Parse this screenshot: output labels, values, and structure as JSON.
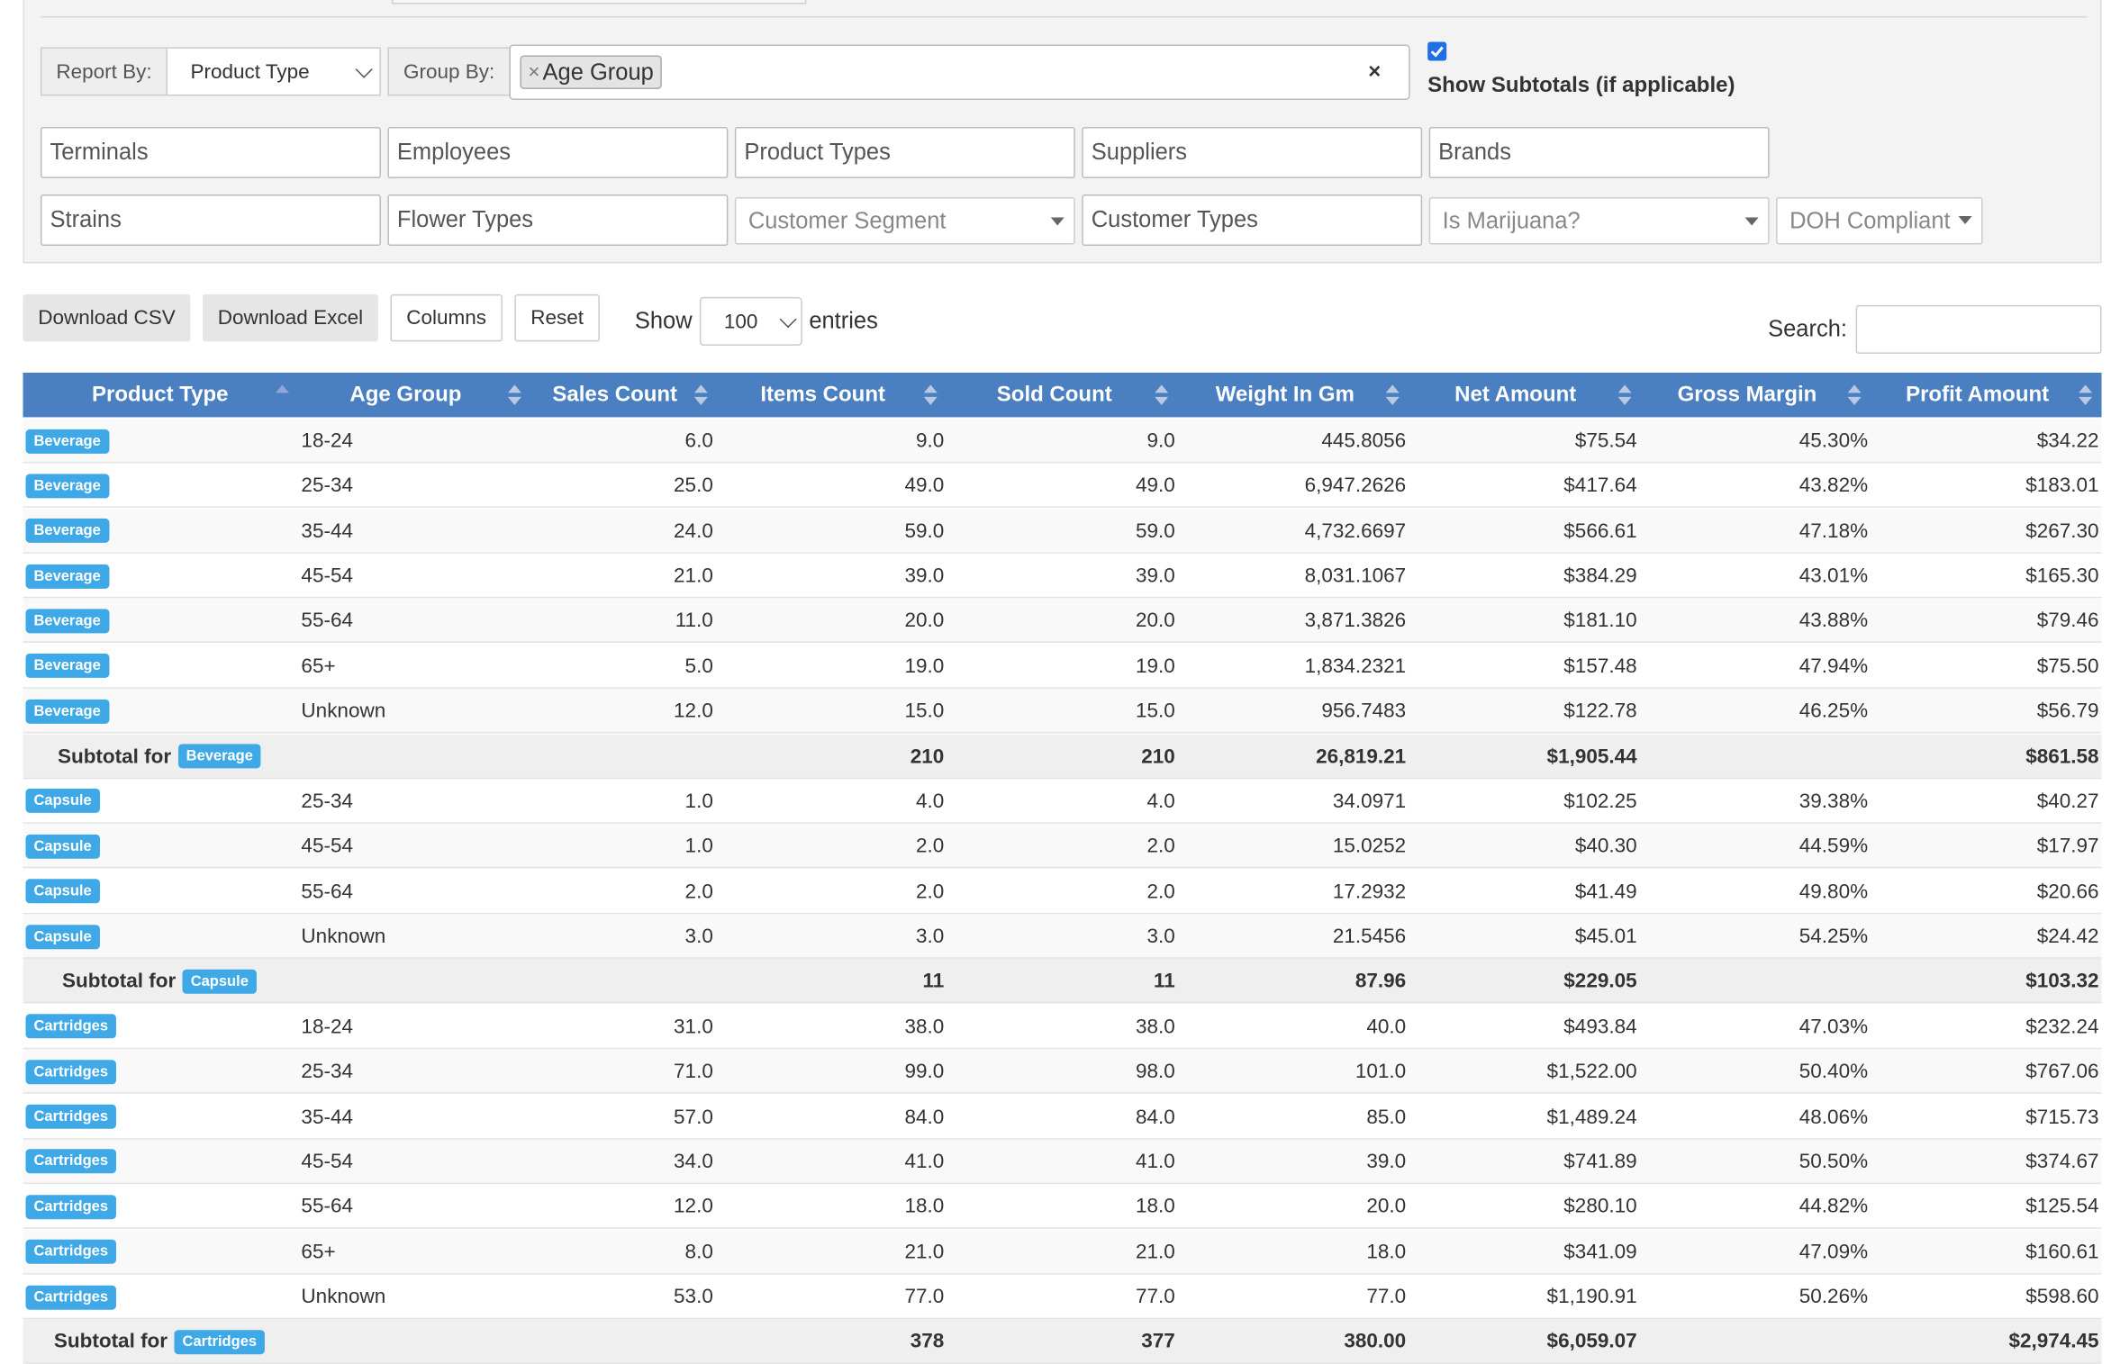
{
  "filters": {
    "report_by_label": "Report By:",
    "report_by_value": "Product Type",
    "group_by_label": "Group By:",
    "group_by_tag": "Age Group",
    "tag_remove": "×",
    "clear": "×",
    "show_subtotals_label": "Show Subtotals (if applicable)",
    "show_subtotals_checked": true,
    "row1": [
      "Terminals",
      "Employees",
      "Product Types",
      "Suppliers",
      "Brands"
    ],
    "row2": {
      "strains": "Strains",
      "flower_types": "Flower Types",
      "customer_segment": "Customer Segment",
      "customer_types": "Customer Types",
      "is_marijuana": "Is Marijuana?",
      "doh_compliant": "DOH Compliant"
    }
  },
  "toolbar": {
    "download_csv": "Download CSV",
    "download_excel": "Download Excel",
    "columns": "Columns",
    "reset": "Reset",
    "show_label": "Show",
    "entries_value": "100",
    "entries_label": "entries",
    "search_label": "Search:",
    "search_value": ""
  },
  "table": {
    "columns": [
      "Product Type",
      "Age Group",
      "Sales Count",
      "Items Count",
      "Sold Count",
      "Weight In Gm",
      "Net Amount",
      "Gross Margin",
      "Profit Amount"
    ],
    "subtotal_prefix": "Subtotal for",
    "rows": [
      {
        "type": "data",
        "product": "Beverage",
        "age": "18-24",
        "sales": "6.0",
        "items": "9.0",
        "sold": "9.0",
        "weight": "445.8056",
        "net": "$75.54",
        "margin": "45.30%",
        "profit": "$34.22"
      },
      {
        "type": "data",
        "product": "Beverage",
        "age": "25-34",
        "sales": "25.0",
        "items": "49.0",
        "sold": "49.0",
        "weight": "6,947.2626",
        "net": "$417.64",
        "margin": "43.82%",
        "profit": "$183.01"
      },
      {
        "type": "data",
        "product": "Beverage",
        "age": "35-44",
        "sales": "24.0",
        "items": "59.0",
        "sold": "59.0",
        "weight": "4,732.6697",
        "net": "$566.61",
        "margin": "47.18%",
        "profit": "$267.30"
      },
      {
        "type": "data",
        "product": "Beverage",
        "age": "45-54",
        "sales": "21.0",
        "items": "39.0",
        "sold": "39.0",
        "weight": "8,031.1067",
        "net": "$384.29",
        "margin": "43.01%",
        "profit": "$165.30"
      },
      {
        "type": "data",
        "product": "Beverage",
        "age": "55-64",
        "sales": "11.0",
        "items": "20.0",
        "sold": "20.0",
        "weight": "3,871.3826",
        "net": "$181.10",
        "margin": "43.88%",
        "profit": "$79.46"
      },
      {
        "type": "data",
        "product": "Beverage",
        "age": "65+",
        "sales": "5.0",
        "items": "19.0",
        "sold": "19.0",
        "weight": "1,834.2321",
        "net": "$157.48",
        "margin": "47.94%",
        "profit": "$75.50"
      },
      {
        "type": "data",
        "product": "Beverage",
        "age": "Unknown",
        "sales": "12.0",
        "items": "15.0",
        "sold": "15.0",
        "weight": "956.7483",
        "net": "$122.78",
        "margin": "46.25%",
        "profit": "$56.79"
      },
      {
        "type": "subtotal",
        "product": "Beverage",
        "items": "210",
        "sold": "210",
        "weight": "26,819.21",
        "net": "$1,905.44",
        "profit": "$861.58"
      },
      {
        "type": "data",
        "product": "Capsule",
        "age": "25-34",
        "sales": "1.0",
        "items": "4.0",
        "sold": "4.0",
        "weight": "34.0971",
        "net": "$102.25",
        "margin": "39.38%",
        "profit": "$40.27"
      },
      {
        "type": "data",
        "product": "Capsule",
        "age": "45-54",
        "sales": "1.0",
        "items": "2.0",
        "sold": "2.0",
        "weight": "15.0252",
        "net": "$40.30",
        "margin": "44.59%",
        "profit": "$17.97"
      },
      {
        "type": "data",
        "product": "Capsule",
        "age": "55-64",
        "sales": "2.0",
        "items": "2.0",
        "sold": "2.0",
        "weight": "17.2932",
        "net": "$41.49",
        "margin": "49.80%",
        "profit": "$20.66"
      },
      {
        "type": "data",
        "product": "Capsule",
        "age": "Unknown",
        "sales": "3.0",
        "items": "3.0",
        "sold": "3.0",
        "weight": "21.5456",
        "net": "$45.01",
        "margin": "54.25%",
        "profit": "$24.42"
      },
      {
        "type": "subtotal",
        "product": "Capsule",
        "items": "11",
        "sold": "11",
        "weight": "87.96",
        "net": "$229.05",
        "profit": "$103.32"
      },
      {
        "type": "data",
        "product": "Cartridges",
        "age": "18-24",
        "sales": "31.0",
        "items": "38.0",
        "sold": "38.0",
        "weight": "40.0",
        "net": "$493.84",
        "margin": "47.03%",
        "profit": "$232.24"
      },
      {
        "type": "data",
        "product": "Cartridges",
        "age": "25-34",
        "sales": "71.0",
        "items": "99.0",
        "sold": "98.0",
        "weight": "101.0",
        "net": "$1,522.00",
        "margin": "50.40%",
        "profit": "$767.06"
      },
      {
        "type": "data",
        "product": "Cartridges",
        "age": "35-44",
        "sales": "57.0",
        "items": "84.0",
        "sold": "84.0",
        "weight": "85.0",
        "net": "$1,489.24",
        "margin": "48.06%",
        "profit": "$715.73"
      },
      {
        "type": "data",
        "product": "Cartridges",
        "age": "45-54",
        "sales": "34.0",
        "items": "41.0",
        "sold": "41.0",
        "weight": "39.0",
        "net": "$741.89",
        "margin": "50.50%",
        "profit": "$374.67"
      },
      {
        "type": "data",
        "product": "Cartridges",
        "age": "55-64",
        "sales": "12.0",
        "items": "18.0",
        "sold": "18.0",
        "weight": "20.0",
        "net": "$280.10",
        "margin": "44.82%",
        "profit": "$125.54"
      },
      {
        "type": "data",
        "product": "Cartridges",
        "age": "65+",
        "sales": "8.0",
        "items": "21.0",
        "sold": "21.0",
        "weight": "18.0",
        "net": "$341.09",
        "margin": "47.09%",
        "profit": "$160.61"
      },
      {
        "type": "data",
        "product": "Cartridges",
        "age": "Unknown",
        "sales": "53.0",
        "items": "77.0",
        "sold": "77.0",
        "weight": "77.0",
        "net": "$1,190.91",
        "margin": "50.26%",
        "profit": "$598.60"
      },
      {
        "type": "subtotal",
        "product": "Cartridges",
        "items": "378",
        "sold": "377",
        "weight": "380.00",
        "net": "$6,059.07",
        "profit": "$2,974.45"
      }
    ]
  }
}
